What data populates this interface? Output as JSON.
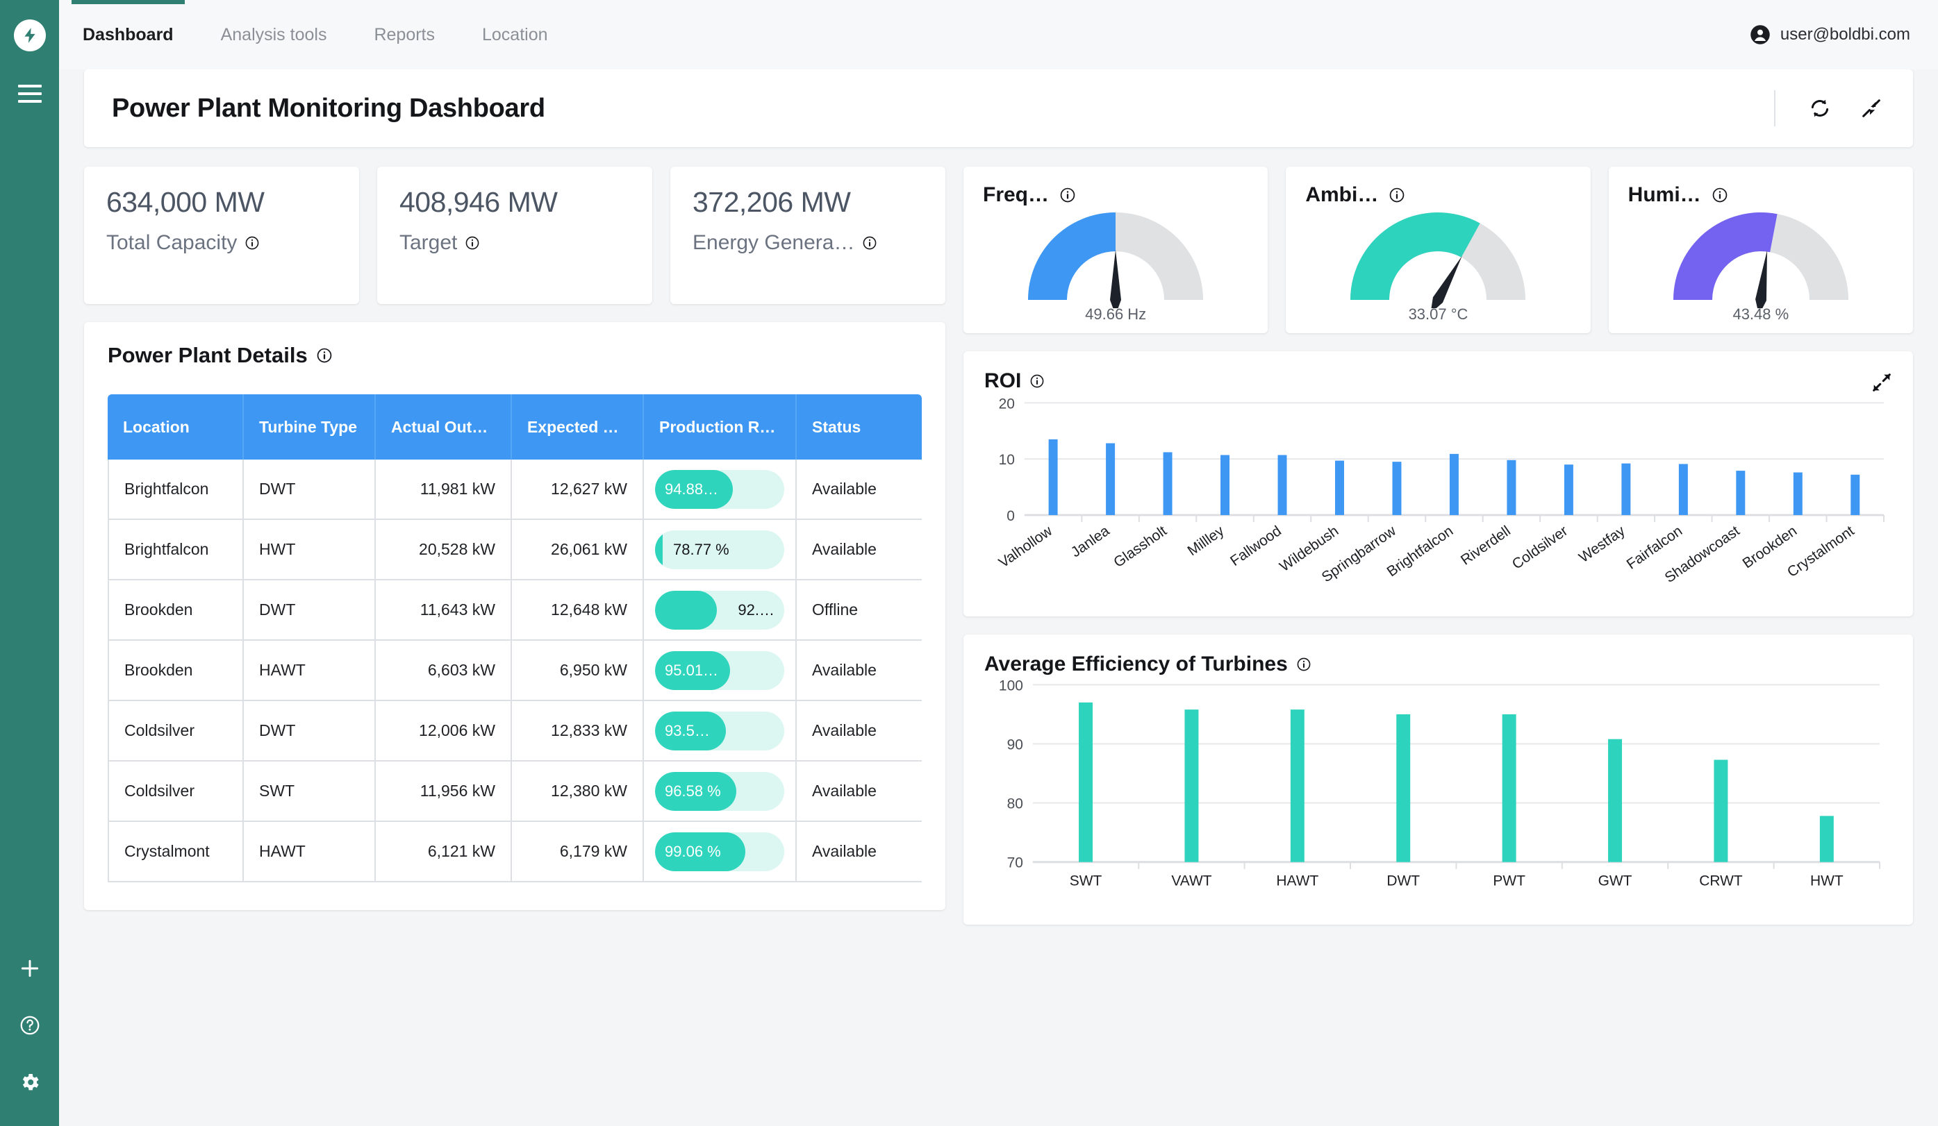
{
  "sidebar": {
    "logo_icon": "lightning-bolt-icon",
    "menu_icon": "hamburger-menu-icon",
    "bottom_items": [
      {
        "icon": "plus-icon",
        "name": "add"
      },
      {
        "icon": "help-circle-icon",
        "name": "help"
      },
      {
        "icon": "gear-icon",
        "name": "settings"
      }
    ]
  },
  "topnav": {
    "tabs": [
      {
        "label": "Dashboard",
        "active": true
      },
      {
        "label": "Analysis tools",
        "active": false
      },
      {
        "label": "Reports",
        "active": false
      },
      {
        "label": "Location",
        "active": false
      }
    ],
    "user_email": "user@boldbi.com",
    "avatar_icon": "user-avatar-icon"
  },
  "header": {
    "title": "Power Plant Monitoring Dashboard",
    "refresh_icon": "refresh-icon",
    "collapse_icon": "collapse-icon"
  },
  "kpis": [
    {
      "value": "634,000 MW",
      "label": "Total Capacity",
      "info_icon": "info-icon"
    },
    {
      "value": "408,946 MW",
      "label": "Target",
      "info_icon": "info-icon"
    },
    {
      "value": "372,206 MW",
      "label": "Energy Genera…",
      "info_icon": "info-icon"
    }
  ],
  "power_plant_details": {
    "title": "Power Plant Details",
    "info_icon": "info-icon",
    "columns": [
      "Location",
      "Turbine Type",
      "Actual Output",
      "Expected Ou…",
      "Production R…",
      "Status"
    ],
    "rows": [
      {
        "location": "Brightfalcon",
        "turbine": "DWT",
        "actual": "11,981 kW",
        "expected": "12,627 kW",
        "rate_text": "94.88…",
        "rate_pct": 60,
        "label_pos": "inside",
        "status": "Available",
        "offline": false
      },
      {
        "location": "Brightfalcon",
        "turbine": "HWT",
        "actual": "20,528 kW",
        "expected": "26,061 kW",
        "rate_text": "78.77 %",
        "rate_pct": 6,
        "label_pos": "outside-left",
        "status": "Available",
        "offline": false
      },
      {
        "location": "Brookden",
        "turbine": "DWT",
        "actual": "11,643 kW",
        "expected": "12,648 kW",
        "rate_text": "92.…",
        "rate_pct": 48,
        "label_pos": "outside",
        "status": "Offline",
        "offline": true
      },
      {
        "location": "Brookden",
        "turbine": "HAWT",
        "actual": "6,603 kW",
        "expected": "6,950 kW",
        "rate_text": "95.01…",
        "rate_pct": 58,
        "label_pos": "inside",
        "status": "Available",
        "offline": false
      },
      {
        "location": "Coldsilver",
        "turbine": "DWT",
        "actual": "12,006 kW",
        "expected": "12,833 kW",
        "rate_text": "93.5…",
        "rate_pct": 55,
        "label_pos": "inside",
        "status": "Available",
        "offline": false
      },
      {
        "location": "Coldsilver",
        "turbine": "SWT",
        "actual": "11,956 kW",
        "expected": "12,380 kW",
        "rate_text": "96.58 %",
        "rate_pct": 63,
        "label_pos": "inside",
        "status": "Available",
        "offline": false
      },
      {
        "location": "Crystalmont",
        "turbine": "HAWT",
        "actual": "6,121 kW",
        "expected": "6,179 kW",
        "rate_text": "99.06 %",
        "rate_pct": 70,
        "label_pos": "inside",
        "status": "Available",
        "offline": false
      }
    ]
  },
  "gauges": [
    {
      "title": "Freq…",
      "value_text": "49.66 Hz",
      "fill_ratio": 0.5,
      "needle_ratio": 0.5,
      "color": "#3d97f3",
      "info_icon": "info-icon"
    },
    {
      "title": "Ambi…",
      "value_text": "33.07 °C",
      "fill_ratio": 0.66,
      "needle_ratio": 0.66,
      "color": "#2ed3bd",
      "info_icon": "info-icon"
    },
    {
      "title": "Humi…",
      "value_text": "43.48 %",
      "fill_ratio": 0.56,
      "needle_ratio": 0.54,
      "color": "#7462f0",
      "info_icon": "info-icon"
    }
  ],
  "chart_data": [
    {
      "id": "roi",
      "type": "bar",
      "title": "ROI",
      "info_icon": "info-icon",
      "expand_icon": "expand-icon",
      "categories": [
        "Valhollow",
        "Janlea",
        "Glassholt",
        "Millley",
        "Fallwood",
        "Wildebush",
        "Springbarrow",
        "Brightfalcon",
        "Riverdell",
        "Coldsilver",
        "Westfay",
        "Fairfalcon",
        "Shadowcoast",
        "Brookden",
        "Crystalmont"
      ],
      "values": [
        13.5,
        12.8,
        11.2,
        10.7,
        10.7,
        9.7,
        9.5,
        10.9,
        9.8,
        9.0,
        9.2,
        9.1,
        7.9,
        7.6,
        7.2
      ],
      "xlabel": "",
      "ylabel": "",
      "yticks": [
        0,
        10,
        20
      ],
      "ylim": [
        0,
        20
      ],
      "bar_color": "#3d97f3",
      "grid": true,
      "legend": "none"
    },
    {
      "id": "efficiency",
      "type": "bar",
      "title": "Average Efficiency of Turbines",
      "info_icon": "info-icon",
      "categories": [
        "SWT",
        "VAWT",
        "HAWT",
        "DWT",
        "PWT",
        "GWT",
        "CRWT",
        "HWT"
      ],
      "values": [
        97.0,
        95.8,
        95.8,
        95.0,
        95.0,
        90.8,
        87.3,
        77.8
      ],
      "xlabel": "",
      "ylabel": "",
      "yticks": [
        70,
        80,
        90,
        100
      ],
      "ylim": [
        70,
        100
      ],
      "bar_color": "#2ed3bd",
      "grid": true,
      "legend": "none"
    }
  ],
  "colors": {
    "sidebar": "#2f7f72",
    "table_header": "#3d97f3",
    "accent_teal": "#2ed3bd",
    "offline_red": "#f0563c",
    "purple": "#7462f0"
  }
}
